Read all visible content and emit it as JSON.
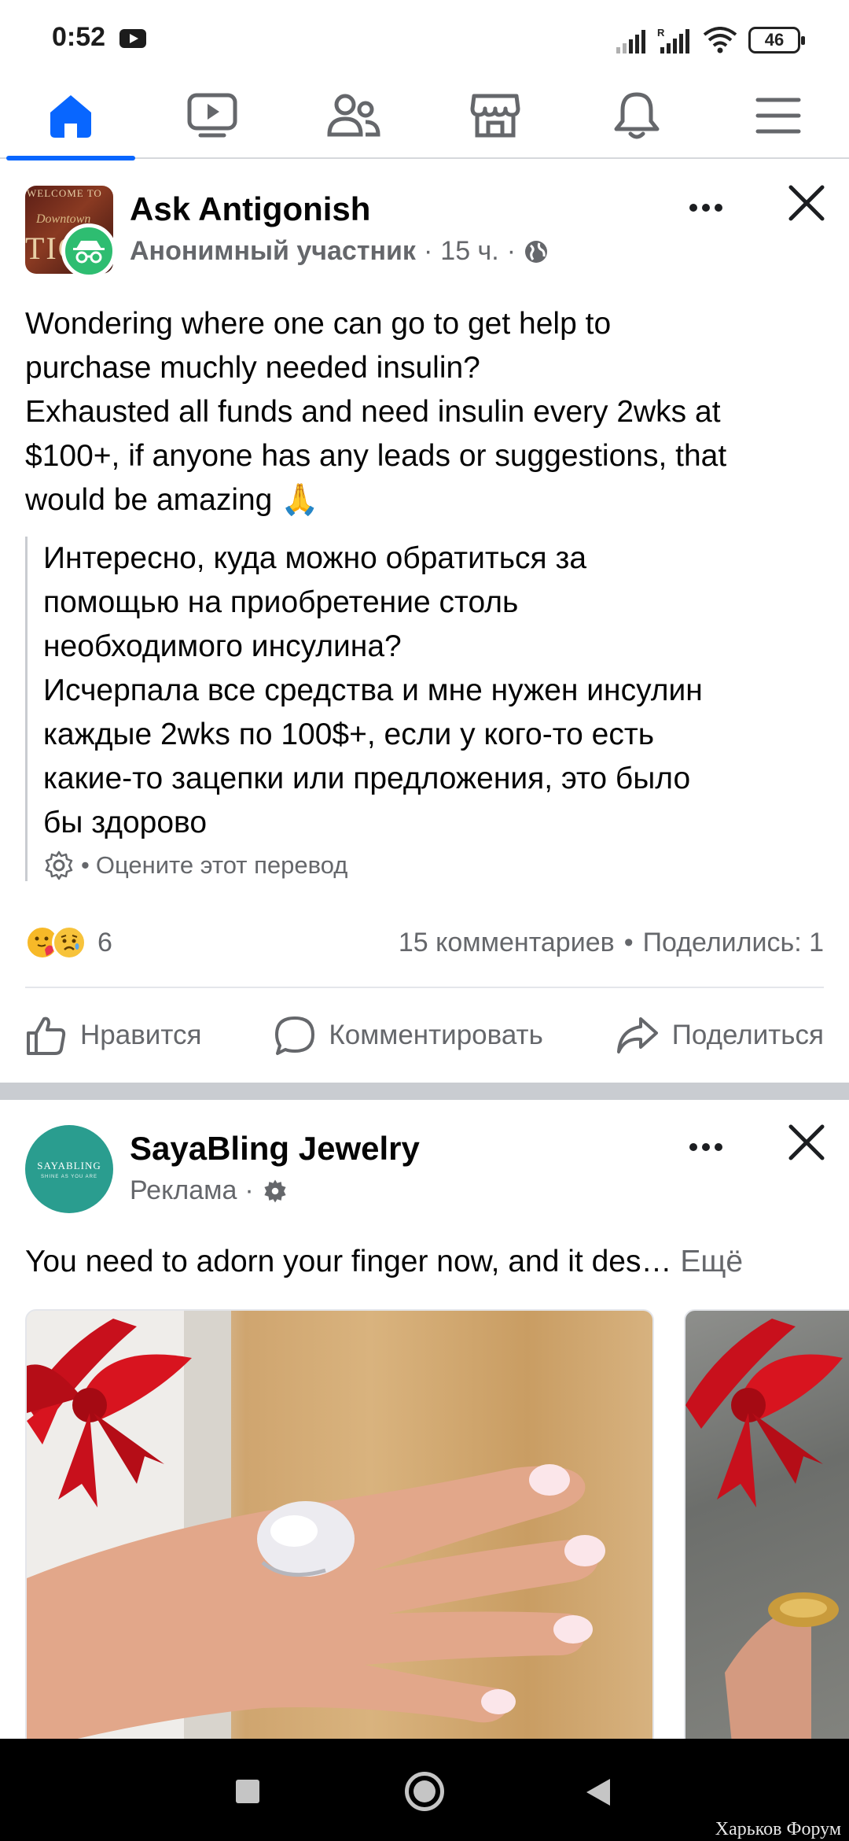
{
  "status_bar": {
    "time": "0:52",
    "battery": "46",
    "icons": [
      "youtube-icon",
      "signal-icon",
      "signal-roaming-icon",
      "wifi-icon",
      "battery-icon"
    ]
  },
  "nav": {
    "active_index": 0,
    "items": [
      "home-icon",
      "video-icon",
      "friends-icon",
      "marketplace-icon",
      "notifications-icon",
      "menu-icon"
    ],
    "accent_color": "#0866ff"
  },
  "post1": {
    "group_name": "Ask Antigonish",
    "author": "Анонимный участник",
    "time": "15 ч.",
    "sep": "·",
    "avatar_text": {
      "line1": "WELCOME TO",
      "line2": "Downtown",
      "line3": "TIG"
    },
    "text_lines": [
      "Wondering where one can go to get help to",
      "purchase muchly needed insulin?",
      "Exhausted all funds and need insulin every 2wks at",
      "$100+, if anyone has any leads or suggestions, that",
      "would be amazing 🙏"
    ],
    "translation_lines": [
      "Интересно, куда можно обратиться за",
      "помощью на приобретение столь",
      "необходимого инсулина?",
      "Исчерпала все средства и мне нужен инсулин",
      "каждые 2wks по 100$+, если у кого-то есть",
      "какие-то зацепки или предложения, это было",
      "бы здорово"
    ],
    "rate_translation": "Оцените этот перевод",
    "reaction_count": "6",
    "comments": "15 комментариев",
    "shares": "Поделились: 1",
    "bullet": "•",
    "like": "Нравится",
    "comment": "Комментировать",
    "share": "Поделиться"
  },
  "post2": {
    "page_name": "SayaBling Jewelry",
    "sponsored": "Реклама",
    "sep": "·",
    "avatar_brand": "SAYABLING",
    "avatar_tagline": "SHINE AS YOU ARE",
    "text": "You need to adorn your finger now, and it des…",
    "see_more": "Ещё"
  },
  "watermark": "Харьков Форум"
}
